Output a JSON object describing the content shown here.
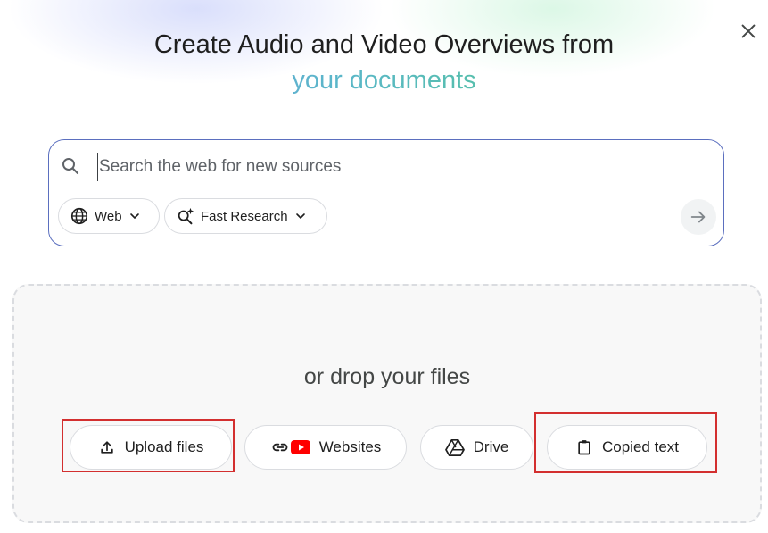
{
  "header": {
    "title_line1": "Create Audio and Video Overviews from",
    "title_line2": "your documents"
  },
  "close": {
    "icon": "close-icon"
  },
  "search": {
    "placeholder": "Search the web for new sources",
    "value": "",
    "source_filter": "Web",
    "mode": "Fast Research"
  },
  "drop_zone": {
    "label": "or drop your files",
    "buttons": [
      {
        "label": "Upload files",
        "icon": "upload-icon"
      },
      {
        "label": "Websites",
        "icon": "link-youtube-icon"
      },
      {
        "label": "Drive",
        "icon": "drive-icon"
      },
      {
        "label": "Copied text",
        "icon": "clipboard-icon"
      }
    ]
  },
  "colors": {
    "search_border": "#5b6fbf",
    "highlight_box": "#d32f2f",
    "youtube_red": "#ff0000",
    "gradient_start": "#7c9bf0",
    "gradient_end": "#4fcf72"
  }
}
